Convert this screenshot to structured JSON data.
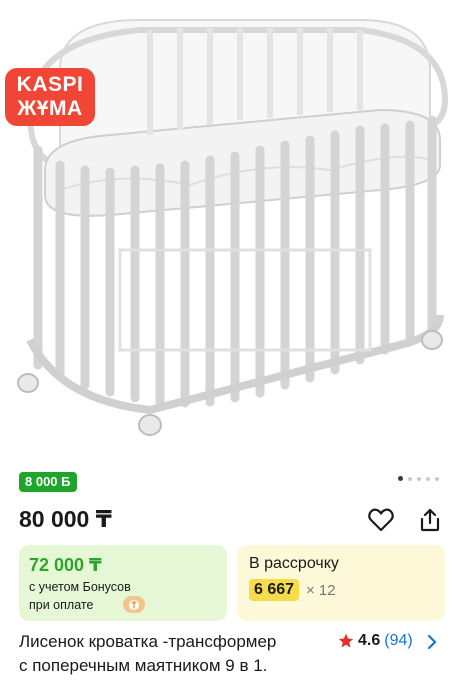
{
  "promo": {
    "line1": "KASPI",
    "line2": "ЖҰМА"
  },
  "gallery": {
    "total_images": 5,
    "active_index": 0
  },
  "bonus_badge": "8 000 Б",
  "price": "80 000 ₸",
  "bonus_card": {
    "amount": "72 000 ₸",
    "note_line1": "с учетом Бонусов",
    "note_line2": "при оплате"
  },
  "credit_card": {
    "title": "В рассрочку",
    "monthly": "6 667",
    "months": "× 12"
  },
  "product": {
    "title_line1": "Лисенок кроватка -трансформер",
    "title_line2": "с поперечным маятником 9 в 1.",
    "rating": "4.6",
    "reviews": "(94)"
  },
  "icons": {
    "favorite": "heart-icon",
    "share": "share-icon",
    "rating": "star-icon",
    "more": "chevron-right-icon"
  },
  "colors": {
    "promo": "#f14635",
    "bonus_green": "#1ea52c",
    "credit_yellow": "#f6dc4a",
    "star": "#e2302a",
    "link": "#1677d2"
  }
}
